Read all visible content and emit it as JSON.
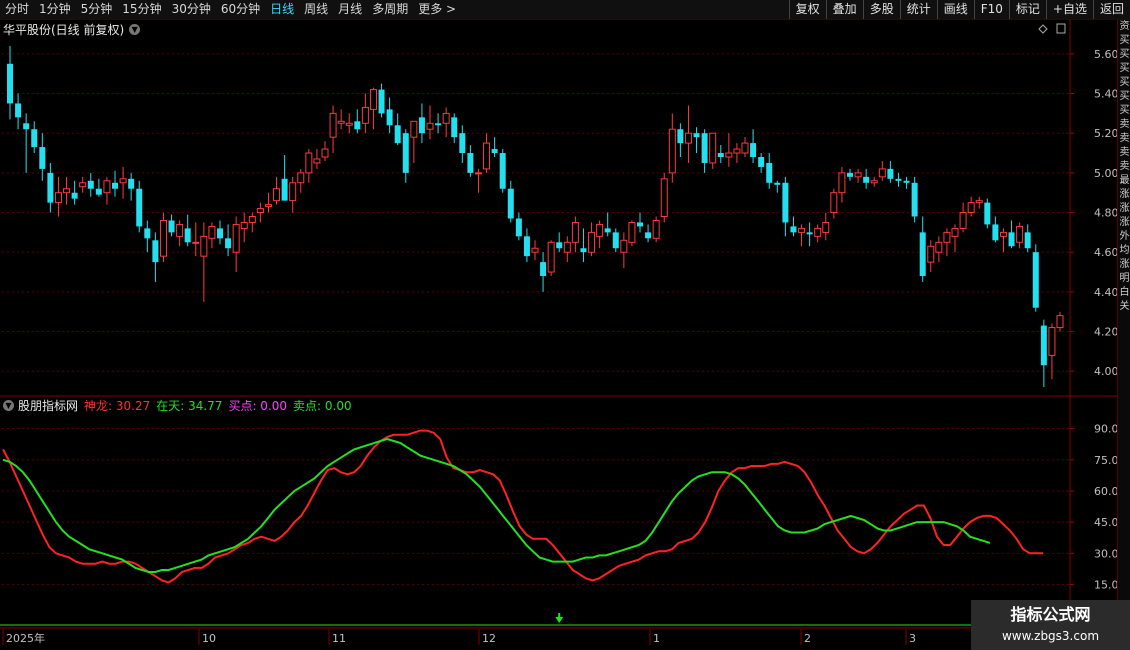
{
  "toolbar": {
    "periods": [
      "分时",
      "1分钟",
      "5分钟",
      "15分钟",
      "30分钟",
      "60分钟",
      "日线",
      "周线",
      "月线",
      "多周期",
      "更多 >"
    ],
    "active_period": "日线",
    "actions": [
      "复权",
      "叠加",
      "多股",
      "统计",
      "画线",
      "F10",
      "标记",
      "+自选",
      "返回"
    ]
  },
  "main_chart": {
    "title": "华平股份(日线 前复权)",
    "price_axis": [
      "5.60",
      "5.40",
      "5.20",
      "5.00",
      "4.80",
      "4.60",
      "4.40",
      "4.20",
      "4.00"
    ],
    "price_range": [
      3.88,
      5.68
    ],
    "up_color": "#ff3a3a",
    "down_color": "#22e0f0"
  },
  "indicator": {
    "name": "股朋指标网",
    "items": [
      {
        "label": "神龙:",
        "value": "30.27",
        "color": "#ff3030"
      },
      {
        "label": "在天:",
        "value": "34.77",
        "color": "#22e022"
      },
      {
        "label": "买点:",
        "value": "0.00",
        "color": "#ff40ff"
      },
      {
        "label": "卖点:",
        "value": "0.00",
        "color": "#22e022"
      }
    ],
    "axis": [
      "90.00",
      "75.00",
      "60.00",
      "45.00",
      "30.00",
      "15.00"
    ],
    "range": [
      9,
      97
    ]
  },
  "date_axis": [
    "2025年",
    "10",
    "11",
    "12",
    "1",
    "2",
    "3"
  ],
  "side_strip_chars": [
    "资",
    "买",
    "买",
    "买",
    "买",
    "买",
    "买",
    "卖",
    "卖",
    "卖",
    "卖",
    "最",
    "涨",
    "涨",
    "涨",
    "外",
    "均",
    "涨",
    "明",
    "白",
    "关"
  ],
  "watermark": {
    "line1": "指标公式网",
    "line2": "www.zbgs3.com"
  },
  "chart_data": {
    "type": "candlestick",
    "series": [
      {
        "name": "华平股份",
        "ohlc": [
          [
            5.55,
            5.64,
            5.27,
            5.35
          ],
          [
            5.35,
            5.4,
            5.22,
            5.28
          ],
          [
            5.25,
            5.3,
            5.0,
            5.22
          ],
          [
            5.22,
            5.26,
            5.1,
            5.13
          ],
          [
            5.13,
            5.2,
            4.96,
            5.02
          ],
          [
            5.0,
            5.05,
            4.8,
            4.85
          ],
          [
            4.85,
            4.98,
            4.78,
            4.9
          ],
          [
            4.9,
            4.98,
            4.84,
            4.92
          ],
          [
            4.9,
            4.96,
            4.84,
            4.87
          ],
          [
            4.93,
            4.98,
            4.9,
            4.95
          ],
          [
            4.96,
            5.0,
            4.88,
            4.92
          ],
          [
            4.92,
            4.97,
            4.88,
            4.89
          ],
          [
            4.9,
            4.98,
            4.84,
            4.96
          ],
          [
            4.95,
            5.01,
            4.88,
            4.92
          ],
          [
            4.95,
            5.03,
            4.87,
            4.97
          ],
          [
            4.97,
            5.0,
            4.86,
            4.92
          ],
          [
            4.92,
            4.96,
            4.7,
            4.73
          ],
          [
            4.72,
            4.76,
            4.6,
            4.67
          ],
          [
            4.66,
            4.7,
            4.45,
            4.55
          ],
          [
            4.58,
            4.8,
            4.55,
            4.76
          ],
          [
            4.76,
            4.79,
            4.68,
            4.7
          ],
          [
            4.68,
            4.76,
            4.63,
            4.74
          ],
          [
            4.72,
            4.79,
            4.63,
            4.65
          ],
          [
            4.65,
            4.75,
            4.58,
            4.65
          ],
          [
            4.58,
            4.75,
            4.35,
            4.68
          ],
          [
            4.67,
            4.75,
            4.62,
            4.73
          ],
          [
            4.72,
            4.76,
            4.64,
            4.67
          ],
          [
            4.67,
            4.74,
            4.58,
            4.62
          ],
          [
            4.6,
            4.78,
            4.5,
            4.74
          ],
          [
            4.72,
            4.8,
            4.65,
            4.75
          ],
          [
            4.75,
            4.8,
            4.7,
            4.78
          ],
          [
            4.8,
            4.85,
            4.75,
            4.82
          ],
          [
            4.83,
            4.9,
            4.8,
            4.84
          ],
          [
            4.86,
            4.98,
            4.84,
            4.92
          ],
          [
            4.97,
            5.09,
            4.88,
            4.86
          ],
          [
            4.86,
            4.98,
            4.8,
            4.95
          ],
          [
            4.95,
            5.02,
            4.9,
            5.0
          ],
          [
            5.0,
            5.12,
            4.95,
            5.1
          ],
          [
            5.05,
            5.12,
            5.02,
            5.07
          ],
          [
            5.08,
            5.16,
            5.06,
            5.12
          ],
          [
            5.18,
            5.34,
            5.1,
            5.3
          ],
          [
            5.25,
            5.32,
            5.22,
            5.26
          ],
          [
            5.24,
            5.3,
            5.2,
            5.25
          ],
          [
            5.26,
            5.32,
            5.2,
            5.22
          ],
          [
            5.25,
            5.4,
            5.2,
            5.33
          ],
          [
            5.32,
            5.43,
            5.22,
            5.42
          ],
          [
            5.42,
            5.45,
            5.28,
            5.3
          ],
          [
            5.32,
            5.38,
            5.2,
            5.24
          ],
          [
            5.24,
            5.3,
            5.14,
            5.15
          ],
          [
            5.2,
            5.22,
            4.95,
            5.0
          ],
          [
            5.18,
            5.26,
            5.05,
            5.26
          ],
          [
            5.28,
            5.35,
            5.15,
            5.2
          ],
          [
            5.22,
            5.34,
            5.17,
            5.25
          ],
          [
            5.25,
            5.3,
            5.2,
            5.24
          ],
          [
            5.25,
            5.33,
            5.18,
            5.3
          ],
          [
            5.28,
            5.3,
            5.15,
            5.18
          ],
          [
            5.2,
            5.24,
            5.05,
            5.1
          ],
          [
            5.1,
            5.14,
            4.98,
            5.0
          ],
          [
            5.0,
            5.02,
            4.9,
            5.0
          ],
          [
            5.02,
            5.2,
            5.0,
            5.15
          ],
          [
            5.12,
            5.18,
            5.08,
            5.1
          ],
          [
            5.1,
            5.12,
            4.9,
            4.92
          ],
          [
            4.92,
            4.96,
            4.75,
            4.77
          ],
          [
            4.77,
            4.8,
            4.66,
            4.68
          ],
          [
            4.68,
            4.72,
            4.55,
            4.58
          ],
          [
            4.6,
            4.66,
            4.56,
            4.62
          ],
          [
            4.55,
            4.6,
            4.4,
            4.48
          ],
          [
            4.5,
            4.66,
            4.48,
            4.65
          ],
          [
            4.65,
            4.7,
            4.6,
            4.62
          ],
          [
            4.6,
            4.68,
            4.55,
            4.65
          ],
          [
            4.65,
            4.78,
            4.6,
            4.75
          ],
          [
            4.62,
            4.72,
            4.55,
            4.6
          ],
          [
            4.6,
            4.75,
            4.58,
            4.7
          ],
          [
            4.68,
            4.76,
            4.62,
            4.74
          ],
          [
            4.72,
            4.8,
            4.68,
            4.7
          ],
          [
            4.7,
            4.72,
            4.6,
            4.62
          ],
          [
            4.6,
            4.7,
            4.52,
            4.66
          ],
          [
            4.65,
            4.76,
            4.63,
            4.75
          ],
          [
            4.75,
            4.8,
            4.7,
            4.73
          ],
          [
            4.7,
            4.74,
            4.65,
            4.67
          ],
          [
            4.67,
            4.78,
            4.65,
            4.76
          ],
          [
            4.78,
            5.0,
            4.75,
            4.97
          ],
          [
            5.0,
            5.3,
            4.95,
            5.22
          ],
          [
            5.22,
            5.25,
            5.08,
            5.15
          ],
          [
            5.15,
            5.34,
            5.05,
            5.2
          ],
          [
            5.2,
            5.23,
            5.1,
            5.18
          ],
          [
            5.2,
            5.22,
            5.0,
            5.05
          ],
          [
            5.05,
            5.2,
            5.02,
            5.2
          ],
          [
            5.1,
            5.14,
            5.05,
            5.08
          ],
          [
            5.08,
            5.2,
            5.03,
            5.1
          ],
          [
            5.1,
            5.15,
            5.05,
            5.12
          ],
          [
            5.1,
            5.18,
            5.08,
            5.15
          ],
          [
            5.15,
            5.22,
            5.05,
            5.08
          ],
          [
            5.08,
            5.1,
            5.0,
            5.03
          ],
          [
            5.05,
            5.1,
            4.92,
            4.95
          ],
          [
            4.95,
            4.96,
            4.9,
            4.94
          ],
          [
            4.95,
            4.98,
            4.68,
            4.75
          ],
          [
            4.73,
            4.78,
            4.68,
            4.7
          ],
          [
            4.7,
            4.74,
            4.63,
            4.72
          ],
          [
            4.7,
            4.75,
            4.63,
            4.69
          ],
          [
            4.68,
            4.74,
            4.65,
            4.72
          ],
          [
            4.7,
            4.8,
            4.66,
            4.75
          ],
          [
            4.8,
            4.92,
            4.77,
            4.9
          ],
          [
            4.9,
            5.03,
            4.85,
            5.0
          ],
          [
            5.0,
            5.02,
            4.96,
            4.98
          ],
          [
            4.98,
            5.02,
            4.95,
            5.0
          ],
          [
            4.98,
            5.02,
            4.92,
            4.95
          ],
          [
            4.95,
            4.98,
            4.93,
            4.96
          ],
          [
            4.98,
            5.06,
            4.96,
            5.02
          ],
          [
            5.02,
            5.06,
            4.95,
            4.97
          ],
          [
            4.97,
            5.0,
            4.93,
            4.96
          ],
          [
            4.96,
            4.98,
            4.92,
            4.95
          ],
          [
            4.95,
            4.98,
            4.75,
            4.78
          ],
          [
            4.7,
            4.78,
            4.45,
            4.48
          ],
          [
            4.55,
            4.66,
            4.5,
            4.63
          ],
          [
            4.6,
            4.68,
            4.55,
            4.65
          ],
          [
            4.65,
            4.72,
            4.58,
            4.7
          ],
          [
            4.68,
            4.74,
            4.6,
            4.72
          ],
          [
            4.72,
            4.85,
            4.7,
            4.8
          ],
          [
            4.8,
            4.88,
            4.78,
            4.85
          ],
          [
            4.85,
            4.88,
            4.82,
            4.86
          ],
          [
            4.85,
            4.87,
            4.72,
            4.74
          ],
          [
            4.74,
            4.78,
            4.65,
            4.66
          ],
          [
            4.68,
            4.72,
            4.6,
            4.7
          ],
          [
            4.7,
            4.76,
            4.62,
            4.63
          ],
          [
            4.65,
            4.75,
            4.62,
            4.73
          ],
          [
            4.7,
            4.74,
            4.6,
            4.62
          ],
          [
            4.6,
            4.64,
            4.3,
            4.32
          ],
          [
            4.23,
            4.26,
            3.92,
            4.03
          ],
          [
            4.08,
            4.24,
            3.96,
            4.22
          ],
          [
            4.22,
            4.3,
            4.2,
            4.28
          ]
        ]
      }
    ],
    "indicator_series": [
      {
        "name": "神龙",
        "values": [
          80,
          74,
          67,
          60,
          53,
          46,
          39,
          33,
          30,
          29,
          28,
          26,
          25,
          25,
          25,
          26,
          25,
          25,
          26,
          26,
          25,
          23,
          21,
          19,
          17,
          16,
          18,
          21,
          22,
          23,
          23,
          25,
          28,
          29,
          30,
          32,
          34,
          35,
          37,
          38,
          37,
          36,
          38,
          41,
          45,
          48,
          53,
          59,
          65,
          70,
          71,
          69,
          68,
          69,
          72,
          77,
          81,
          84,
          86,
          87,
          87,
          87,
          88,
          89,
          89,
          88,
          85,
          76,
          71,
          70,
          69,
          69,
          70,
          69,
          68,
          65,
          58,
          50,
          43,
          39,
          37,
          37,
          37,
          34,
          30,
          26,
          22,
          20,
          18,
          17,
          18,
          20,
          22,
          24,
          25,
          26,
          27,
          29,
          30,
          31,
          31,
          32,
          35,
          36,
          37,
          40,
          45,
          52,
          60,
          65,
          69,
          71,
          71,
          72,
          72,
          72,
          73,
          73,
          74,
          73,
          72,
          69,
          64,
          58,
          53,
          47,
          41,
          37,
          33,
          31,
          30,
          32,
          35,
          39,
          43,
          46,
          49,
          51,
          53,
          53,
          47,
          38,
          34,
          34,
          38,
          42,
          45,
          47,
          48,
          48,
          47,
          44,
          41,
          37,
          32,
          30,
          30,
          30
        ]
      },
      {
        "name": "在天",
        "values": [
          75,
          74,
          72,
          69,
          65,
          60,
          55,
          50,
          45,
          41,
          38,
          36,
          34,
          32,
          31,
          30,
          29,
          28,
          27,
          25,
          23,
          22,
          21,
          21,
          22,
          22,
          23,
          24,
          25,
          26,
          27,
          29,
          30,
          31,
          32,
          33,
          35,
          37,
          40,
          43,
          47,
          51,
          54,
          57,
          60,
          62,
          64,
          66,
          69,
          72,
          74,
          76,
          78,
          80,
          81,
          82,
          83,
          84,
          85,
          84,
          83,
          81,
          79,
          77,
          76,
          75,
          74,
          73,
          72,
          70,
          68,
          65,
          62,
          58,
          54,
          50,
          46,
          42,
          38,
          34,
          31,
          28,
          27,
          26,
          26,
          26,
          26,
          27,
          28,
          28,
          29,
          29,
          30,
          31,
          32,
          33,
          34,
          36,
          40,
          45,
          50,
          55,
          59,
          62,
          65,
          67,
          68,
          69,
          69,
          69,
          68,
          66,
          63,
          59,
          55,
          51,
          47,
          43,
          41,
          40,
          40,
          40,
          41,
          42,
          44,
          45,
          46,
          47,
          48,
          47,
          46,
          44,
          42,
          41,
          41,
          42,
          43,
          44,
          45,
          45,
          45,
          45,
          45,
          44,
          43,
          41,
          38,
          37,
          36,
          35
        ]
      }
    ],
    "buy_marker_date_index": 68
  }
}
